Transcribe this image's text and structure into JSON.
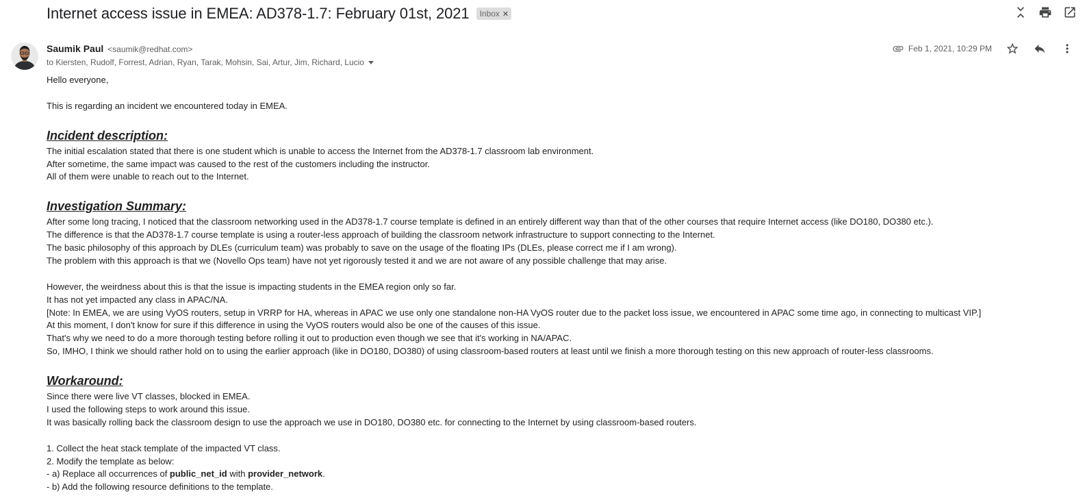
{
  "email": {
    "subject": "Internet access issue in EMEA: AD378-1.7: February 01st, 2021",
    "label": "Inbox",
    "sender_name": "Saumik Paul",
    "sender_email": "<saumik@redhat.com>",
    "recipients": "to Kiersten, Rudolf, Forrest, Adrian, Ryan, Tarak, Mohsin, Sai, Artur, Jim, Richard, Lucio",
    "date": "Feb 1, 2021, 10:29 PM"
  },
  "icons": {
    "collapse": "collapse-all-icon",
    "print": "print-icon",
    "open_new_window": "open-in-new-icon",
    "attachment": "paperclip-icon",
    "star": "star-icon",
    "reply": "reply-icon",
    "more": "more-vert-icon",
    "label_remove": "close-icon"
  },
  "body": {
    "greeting": "Hello everyone,",
    "intro": "This is regarding an incident we encountered today in EMEA.",
    "incident_heading": "Incident description:",
    "incident_lines": [
      "The initial escalation stated that there is one student which is unable to access the Internet from the AD378-1.7 classroom lab environment.",
      "After sometime, the same impact was caused to the rest of the customers including the instructor.",
      "All of them were unable to reach out to the Internet."
    ],
    "investigation_heading": "Investigation Summary:",
    "investigation_lines": [
      "After some long tracing, I noticed that the classroom networking used in the AD378-1.7 course template is defined in an entirely different way than that of the other courses that require Internet access (like DO180, DO380 etc.).",
      "The difference is that the AD378-1.7 course template is using a router-less approach of building the classroom network infrastructure to support connecting to the Internet.",
      "The basic philosophy of this approach by DLEs (curriculum team) was probably to save on the usage of the floating IPs (DLEs, please correct me if I am wrong).",
      "The problem with this approach is that we (Novello Ops team) have not yet rigorously tested it and we are not aware of any possible challenge that may arise."
    ],
    "investigation_lines_2": [
      "However, the weirdness about this is that the issue is impacting students in the EMEA region only so far.",
      "It has not yet impacted any class in APAC/NA.",
      "[Note: In EMEA, we are using VyOS routers, setup in VRRP for HA, whereas in APAC we use only one standalone non-HA VyOS router due to the packet loss issue, we encountered in APAC some time ago, in connecting to multicast VIP.]",
      "At this moment, I don't know for sure if this difference in using the VyOS routers would also be one of the causes of this issue.",
      "That's why we need to do a more thorough testing before rolling it out to production even though we see that it's working in NA/APAC.",
      "So, IMHO, I think we should rather hold on to using the earlier approach (like in DO180, DO380) of using classroom-based routers at least until we finish a more thorough testing on this new approach of router-less classrooms."
    ],
    "workaround_heading": "Workaround:",
    "workaround_lines": [
      "Since there were live VT classes, blocked in EMEA.",
      "I used the following steps to work around this issue.",
      "It was basically rolling back the classroom design to use the approach we use in DO180, DO380 etc. for connecting to the Internet by using classroom-based routers."
    ],
    "steps": {
      "step1": "1. Collect the heat stack template of the impacted VT class.",
      "step2": "2. Modify the template as below:",
      "step2a_prefix": "- a) Replace all occurrences of ",
      "step2a_code1": "public_net_id",
      "step2a_mid": " with ",
      "step2a_code2": "provider_network",
      "step2a_suffix": ".",
      "step2b": "- b) Add the following resource definitions to the template."
    }
  }
}
